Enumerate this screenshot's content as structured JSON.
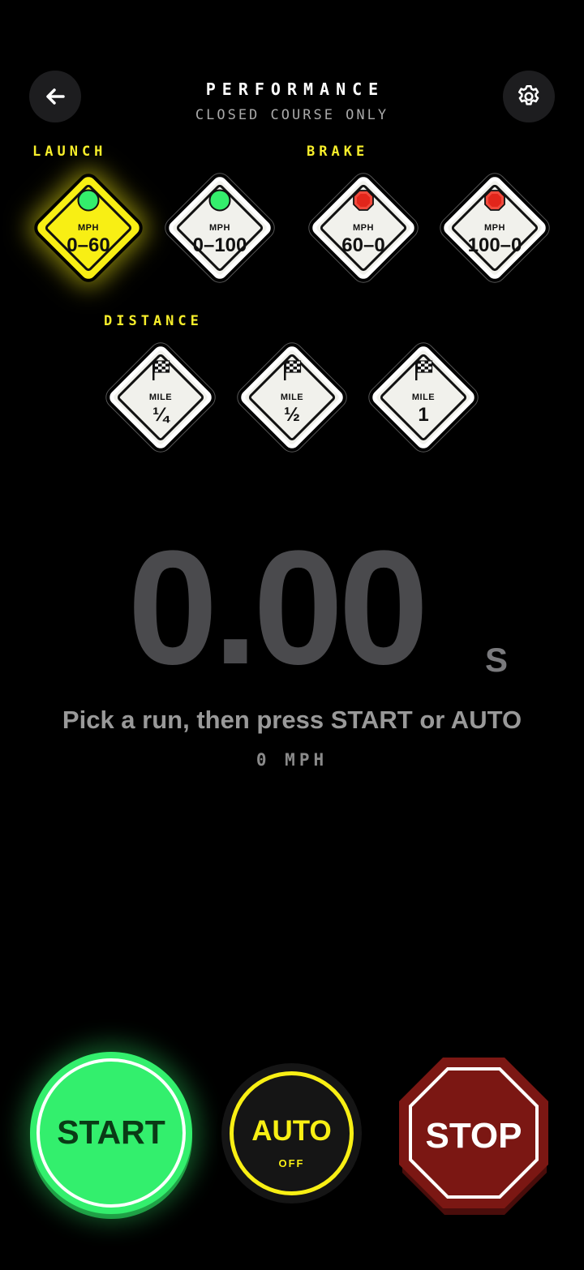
{
  "header": {
    "title": "PERFORMANCE",
    "subtitle": "CLOSED COURSE ONLY",
    "back_icon": "arrow-left-icon",
    "settings_icon": "gear-icon"
  },
  "sections": {
    "launch_label": "LAUNCH",
    "brake_label": "BRAKE",
    "distance_label": "DISTANCE"
  },
  "runs": {
    "launch": [
      {
        "unit": "MPH",
        "value": "0–60",
        "icon": "green-light-icon",
        "selected": true
      },
      {
        "unit": "MPH",
        "value": "0–100",
        "icon": "green-light-icon",
        "selected": false
      }
    ],
    "brake": [
      {
        "unit": "MPH",
        "value": "60–0",
        "icon": "stop-sign-icon",
        "selected": false
      },
      {
        "unit": "MPH",
        "value": "100–0",
        "icon": "stop-sign-icon",
        "selected": false
      }
    ],
    "distance": [
      {
        "unit": "MILE",
        "value": "¼",
        "icon": "checkered-flag-icon",
        "selected": false
      },
      {
        "unit": "MILE",
        "value": "½",
        "icon": "checkered-flag-icon",
        "selected": false
      },
      {
        "unit": "MILE",
        "value": "1",
        "icon": "checkered-flag-icon",
        "selected": false
      }
    ]
  },
  "timer": {
    "value": "0.00",
    "unit": "S",
    "hint": "Pick a run, then press START or AUTO",
    "speed": "0 MPH"
  },
  "controls": {
    "start_label": "START",
    "auto_label": "AUTO",
    "auto_state": "OFF",
    "stop_label": "STOP"
  },
  "colors": {
    "background": "#000000",
    "accent_yellow": "#f8ef14",
    "start_green": "#33ef6d",
    "stop_red": "#7b1713",
    "timer_gray": "#4a4a4d"
  }
}
